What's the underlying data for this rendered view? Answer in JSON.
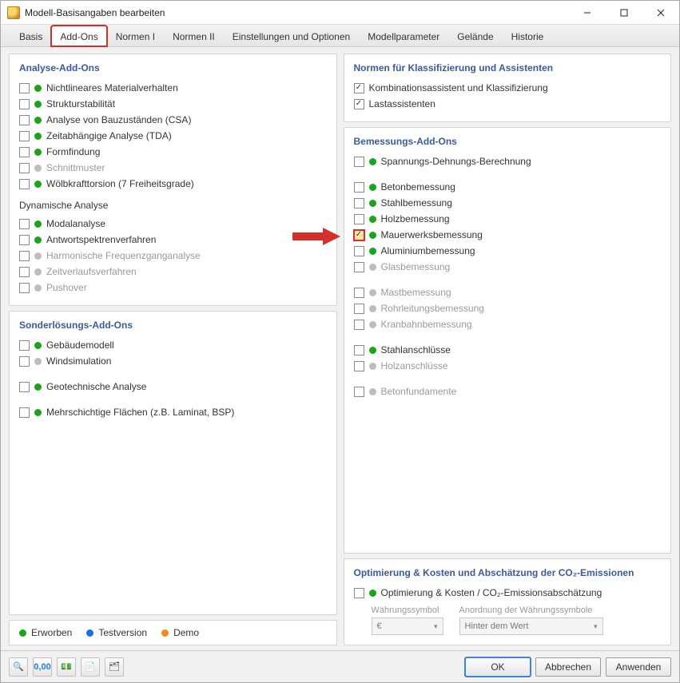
{
  "window": {
    "title": "Modell-Basisangaben bearbeiten"
  },
  "tabs": [
    "Basis",
    "Add-Ons",
    "Normen I",
    "Normen II",
    "Einstellungen und Optionen",
    "Modellparameter",
    "Gelände",
    "Historie"
  ],
  "panels": {
    "analyse": {
      "title": "Analyse-Add-Ons",
      "items": [
        {
          "label": "Nichtlineares Materialverhalten",
          "dot": "g",
          "checked": false,
          "enabled": true
        },
        {
          "label": "Strukturstabilität",
          "dot": "g",
          "checked": false,
          "enabled": true
        },
        {
          "label": "Analyse von Bauzuständen (CSA)",
          "dot": "g",
          "checked": false,
          "enabled": true
        },
        {
          "label": "Zeitabhängige Analyse (TDA)",
          "dot": "g",
          "checked": false,
          "enabled": true
        },
        {
          "label": "Formfindung",
          "dot": "g",
          "checked": false,
          "enabled": true
        },
        {
          "label": "Schnittmuster",
          "dot": "gray",
          "checked": false,
          "enabled": false
        },
        {
          "label": "Wölbkrafttorsion (7 Freiheitsgrade)",
          "dot": "g",
          "checked": false,
          "enabled": true
        }
      ],
      "sub_title": "Dynamische Analyse",
      "sub_items": [
        {
          "label": "Modalanalyse",
          "dot": "g",
          "checked": false,
          "enabled": true
        },
        {
          "label": "Antwortspektrenverfahren",
          "dot": "g",
          "checked": false,
          "enabled": true
        },
        {
          "label": "Harmonische Frequenzganganalyse",
          "dot": "gray",
          "checked": false,
          "enabled": false
        },
        {
          "label": "Zeitverlaufsverfahren",
          "dot": "gray",
          "checked": false,
          "enabled": false
        },
        {
          "label": "Pushover",
          "dot": "gray",
          "checked": false,
          "enabled": false
        }
      ]
    },
    "sonder": {
      "title": "Sonderlösungs-Add-Ons",
      "items": [
        {
          "label": "Gebäudemodell",
          "dot": "g",
          "checked": false,
          "enabled": true
        },
        {
          "label": "Windsimulation",
          "dot": "gray",
          "checked": false,
          "enabled": true
        },
        {
          "label": "Geotechnische Analyse",
          "dot": "g",
          "checked": false,
          "enabled": true
        },
        {
          "label": "Mehrschichtige Flächen (z.B. Laminat, BSP)",
          "dot": "g",
          "checked": false,
          "enabled": true
        }
      ]
    },
    "normen": {
      "title": "Normen für Klassifizierung und Assistenten",
      "items": [
        {
          "label": "Kombinationsassistent und Klassifizierung",
          "checked": true
        },
        {
          "label": "Lastassistenten",
          "checked": true
        }
      ]
    },
    "bemessung": {
      "title": "Bemessungs-Add-Ons",
      "groups": [
        [
          {
            "label": "Spannungs-Dehnungs-Berechnung",
            "dot": "g",
            "checked": false,
            "enabled": true
          }
        ],
        [
          {
            "label": "Betonbemessung",
            "dot": "g",
            "checked": false,
            "enabled": true
          },
          {
            "label": "Stahlbemessung",
            "dot": "g",
            "checked": false,
            "enabled": true
          },
          {
            "label": "Holzbemessung",
            "dot": "g",
            "checked": false,
            "enabled": true
          },
          {
            "label": "Mauerwerksbemessung",
            "dot": "g",
            "checked": true,
            "enabled": true,
            "hl": true
          },
          {
            "label": "Aluminiumbemessung",
            "dot": "g",
            "checked": false,
            "enabled": true
          },
          {
            "label": "Glasbemessung",
            "dot": "gray",
            "checked": false,
            "enabled": false
          }
        ],
        [
          {
            "label": "Mastbemessung",
            "dot": "gray",
            "checked": false,
            "enabled": false
          },
          {
            "label": "Rohrleitungsbemessung",
            "dot": "gray",
            "checked": false,
            "enabled": false
          },
          {
            "label": "Kranbahnbemessung",
            "dot": "gray",
            "checked": false,
            "enabled": false
          }
        ],
        [
          {
            "label": "Stahlanschlüsse",
            "dot": "g",
            "checked": false,
            "enabled": true
          },
          {
            "label": "Holzanschlüsse",
            "dot": "gray",
            "checked": false,
            "enabled": false
          }
        ],
        [
          {
            "label": "Betonfundamente",
            "dot": "gray",
            "checked": false,
            "enabled": false
          }
        ]
      ]
    },
    "opt": {
      "title": "Optimierung & Kosten und Abschätzung der CO₂-Emissionen",
      "item": {
        "label": "Optimierung & Kosten / CO₂-Emissionsabschätzung",
        "dot": "g",
        "checked": false,
        "enabled": true
      },
      "f1_label": "Währungssymbol",
      "f1_value": "€",
      "f2_label": "Anordnung der Währungssymbole",
      "f2_value": "Hinter dem Wert"
    }
  },
  "legend": {
    "a": "Erworben",
    "b": "Testversion",
    "c": "Demo"
  },
  "buttons": {
    "ok": "OK",
    "cancel": "Abbrechen",
    "apply": "Anwenden"
  }
}
